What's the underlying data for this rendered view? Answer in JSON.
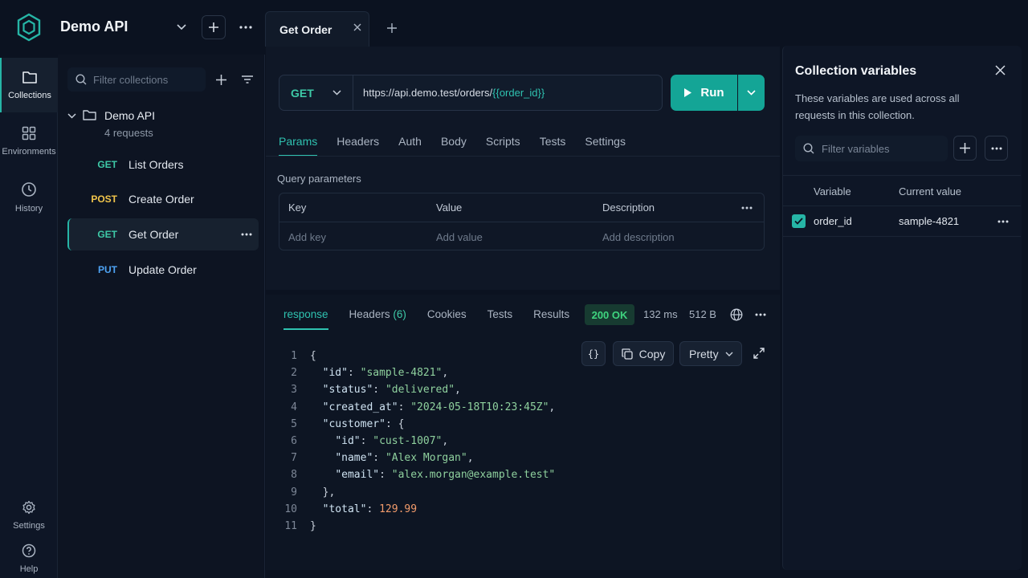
{
  "app": {
    "workspace_name": "Demo API",
    "accent": "#26b5a6"
  },
  "activity_bar": {
    "items": [
      {
        "label": "Collections",
        "icon": "folder-icon",
        "active": true
      },
      {
        "label": "Environments",
        "icon": "grid-icon",
        "active": false
      },
      {
        "label": "History",
        "icon": "clock-icon",
        "active": false
      }
    ],
    "bottom": [
      {
        "label": "Settings",
        "icon": "gear-icon"
      },
      {
        "label": "Help",
        "icon": "help-icon"
      }
    ]
  },
  "sidebar": {
    "filter_placeholder": "Filter collections",
    "collection": {
      "name": "Demo API",
      "count": "4 requests"
    },
    "requests": [
      {
        "method": "GET",
        "name": "List Orders",
        "active": false
      },
      {
        "method": "POST",
        "name": "Create Order",
        "active": false
      },
      {
        "method": "GET",
        "name": "Get Order",
        "active": true
      },
      {
        "method": "PUT",
        "name": "Update Order",
        "active": false
      }
    ]
  },
  "tabs": [
    {
      "label": "Get Order",
      "active": true
    }
  ],
  "request": {
    "method": "GET",
    "url_prefix": "https://api.demo.test/orders/",
    "url_variable": "{{order_id}}",
    "run_label": "Run",
    "tabs": [
      "Params",
      "Headers",
      "Auth",
      "Body",
      "Scripts",
      "Tests",
      "Settings"
    ],
    "active_tab": "Params",
    "query_params": {
      "label": "Query parameters",
      "columns": [
        "Key",
        "Value",
        "Description"
      ],
      "placeholders": [
        "Add key",
        "Add value",
        "Add description"
      ]
    }
  },
  "response": {
    "tabs": [
      {
        "label": "response",
        "count": ""
      },
      {
        "label": "Headers",
        "count": "(6)"
      },
      {
        "label": "Cookies",
        "count": ""
      },
      {
        "label": "Tests",
        "count": ""
      },
      {
        "label": "Results",
        "count": ""
      }
    ],
    "status": "200 OK",
    "status_color": "#3fd47f",
    "time": "132 ms",
    "size": "512 B",
    "toolbar": {
      "format_glyph": "{}",
      "copy": "Copy",
      "view": "Pretty"
    },
    "body_lines": [
      [
        {
          "t": "p",
          "v": "{"
        }
      ],
      [
        {
          "t": "p",
          "v": "  "
        },
        {
          "t": "key",
          "v": "\"id\""
        },
        {
          "t": "p",
          "v": ": "
        },
        {
          "t": "str",
          "v": "\"sample-4821\""
        },
        {
          "t": "p",
          "v": ","
        }
      ],
      [
        {
          "t": "p",
          "v": "  "
        },
        {
          "t": "key",
          "v": "\"status\""
        },
        {
          "t": "p",
          "v": ": "
        },
        {
          "t": "str",
          "v": "\"delivered\""
        },
        {
          "t": "p",
          "v": ","
        }
      ],
      [
        {
          "t": "p",
          "v": "  "
        },
        {
          "t": "key",
          "v": "\"created_at\""
        },
        {
          "t": "p",
          "v": ": "
        },
        {
          "t": "str",
          "v": "\"2024-05-18T10:23:45Z\""
        },
        {
          "t": "p",
          "v": ","
        }
      ],
      [
        {
          "t": "p",
          "v": "  "
        },
        {
          "t": "key",
          "v": "\"customer\""
        },
        {
          "t": "p",
          "v": ": {"
        }
      ],
      [
        {
          "t": "p",
          "v": "    "
        },
        {
          "t": "key",
          "v": "\"id\""
        },
        {
          "t": "p",
          "v": ": "
        },
        {
          "t": "str",
          "v": "\"cust-1007\""
        },
        {
          "t": "p",
          "v": ","
        }
      ],
      [
        {
          "t": "p",
          "v": "    "
        },
        {
          "t": "key",
          "v": "\"name\""
        },
        {
          "t": "p",
          "v": ": "
        },
        {
          "t": "str",
          "v": "\"Alex Morgan\""
        },
        {
          "t": "p",
          "v": ","
        }
      ],
      [
        {
          "t": "p",
          "v": "    "
        },
        {
          "t": "key",
          "v": "\"email\""
        },
        {
          "t": "p",
          "v": ": "
        },
        {
          "t": "str",
          "v": "\"alex.morgan@example.test\""
        }
      ],
      [
        {
          "t": "p",
          "v": "  },"
        }
      ],
      [
        {
          "t": "p",
          "v": "  "
        },
        {
          "t": "key",
          "v": "\"total\""
        },
        {
          "t": "p",
          "v": ": "
        },
        {
          "t": "num",
          "v": "129.99"
        }
      ],
      [
        {
          "t": "p",
          "v": "}"
        }
      ]
    ]
  },
  "variables_panel": {
    "title": "Collection variables",
    "description": "These variables are used across all requests in this collection.",
    "filter_placeholder": "Filter variables",
    "columns": [
      "Variable",
      "Current value"
    ],
    "rows": [
      {
        "enabled": true,
        "name": "order_id",
        "value": "sample-4821"
      }
    ]
  }
}
